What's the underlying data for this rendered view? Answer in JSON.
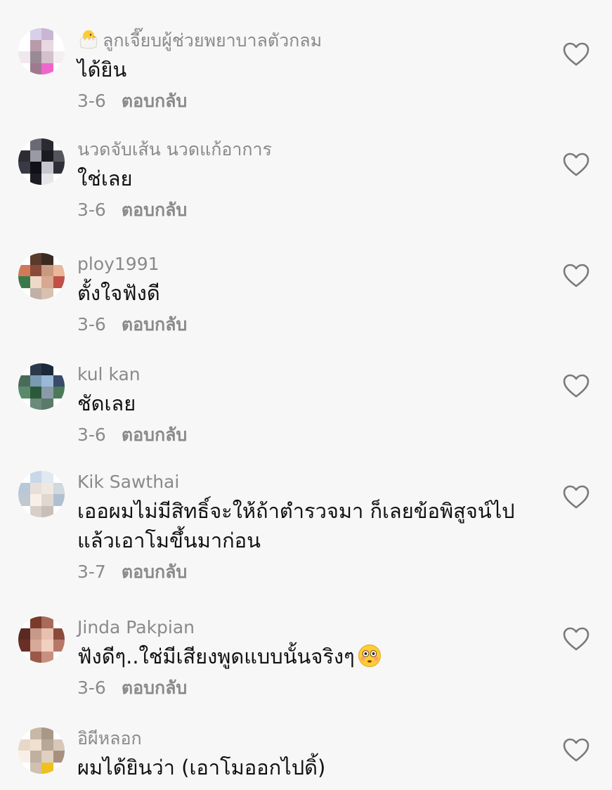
{
  "comments": [
    {
      "username": "ลูกเจี๊ยบผู้ช่วยพยาบาลตัวกลม",
      "username_icon": "hatching-chick-icon",
      "text": "ได้ยิน",
      "date": "3-6",
      "reply_label": "ตอบกลับ",
      "avatar_colors": [
        "#ffffff",
        "#d8d0e8",
        "#c9b6d4",
        "#ffffff",
        "#ffffff",
        "#b89aa8",
        "#e8d8e0",
        "#ffffff",
        "#f0e8ee",
        "#9a8a96",
        "#d4c0cc",
        "#f3eef2",
        "#ffffff",
        "#a07890",
        "#ee66cc",
        "#ffffff"
      ]
    },
    {
      "username": "นวดจับเส้น นวดแก้อาการ",
      "text": "ใช่เลย",
      "date": "3-6",
      "reply_label": "ตอบกลับ",
      "avatar_colors": [
        "#ffffff",
        "#6a6a74",
        "#2a2a30",
        "#ffffff",
        "#2c2c34",
        "#9a9aa4",
        "#1a1a22",
        "#55555e",
        "#3a3a44",
        "#101018",
        "#c6c6ce",
        "#2e2e36",
        "#ffffff",
        "#1c1c24",
        "#e6e6ea",
        "#ffffff"
      ]
    },
    {
      "username": "ploy1991",
      "text": "ตั้งใจฟังดี",
      "date": "3-6",
      "reply_label": "ตอบกลับ",
      "avatar_colors": [
        "#ffffff",
        "#5a3a2a",
        "#3a2a22",
        "#ffffff",
        "#d07a5a",
        "#8a4a3a",
        "#c89a80",
        "#e8b89a",
        "#3a7a4a",
        "#f0d8c8",
        "#d8a890",
        "#c05048",
        "#ffffff",
        "#c0b0a8",
        "#d8c0b0",
        "#ffffff"
      ]
    },
    {
      "username": "kul kan",
      "text": "ชัดเลย",
      "date": "3-6",
      "reply_label": "ตอบกลับ",
      "avatar_colors": [
        "#ffffff",
        "#2a3a4a",
        "#1a2a3a",
        "#ffffff",
        "#4a6a5a",
        "#7a9ab0",
        "#9ab8d8",
        "#3a4a6a",
        "#5a8a6a",
        "#2a5a3a",
        "#8a9aa8",
        "#4a7a5a",
        "#ffffff",
        "#6a8a7a",
        "#5a7a6a",
        "#ffffff"
      ]
    },
    {
      "username": "Kik Sawthai",
      "text": "เออผมไม่มีสิทธิ์จะให้ถ้าตำรวจมา ก็เลยข้อพิสูจน์ไป แล้วเอาโมขึ้นมาก่อน",
      "date": "3-7",
      "reply_label": "ตอบกลับ",
      "avatar_colors": [
        "#ffffff",
        "#c8d8e8",
        "#e0e8f0",
        "#ffffff",
        "#b8c8d8",
        "#e8e0d8",
        "#f0e8e0",
        "#d0d8e0",
        "#c0c8d0",
        "#f8f0e8",
        "#e0d8d0",
        "#b0c0d0",
        "#ffffff",
        "#d8d0c8",
        "#c8c0b8",
        "#ffffff"
      ]
    },
    {
      "username": "Jinda Pakpian",
      "text": "ฟังดีๆ..ใช่มีเสียงพูดแบบนั้นจริงๆ",
      "text_emoji": "flushed-face-icon",
      "date": "3-6",
      "reply_label": "ตอบกลับ",
      "avatar_colors": [
        "#ffffff",
        "#7a3a2a",
        "#a86a5a",
        "#ffffff",
        "#5a2a22",
        "#c89888",
        "#e8c0b0",
        "#8a4a3a",
        "#6a3028",
        "#d8a898",
        "#f0d0c0",
        "#b87868",
        "#ffffff",
        "#9a5848",
        "#c89080",
        "#ffffff"
      ]
    },
    {
      "username": "อิผีหลอก",
      "text": "ผมได้ยินว่า (เอาโมออกไปดิ้)",
      "date": "",
      "reply_label": "",
      "avatar_colors": [
        "#ffffff",
        "#c8b8a8",
        "#a89888",
        "#ffffff",
        "#e8d8c8",
        "#f0e0d0",
        "#b8a898",
        "#d8c8b8",
        "#f8f0e8",
        "#c0b0a0",
        "#e0d0c0",
        "#a89080",
        "#ffffff",
        "#d0c0b0",
        "#f0c020",
        "#ffffff"
      ]
    }
  ],
  "like_icon": "heart-outline-icon"
}
